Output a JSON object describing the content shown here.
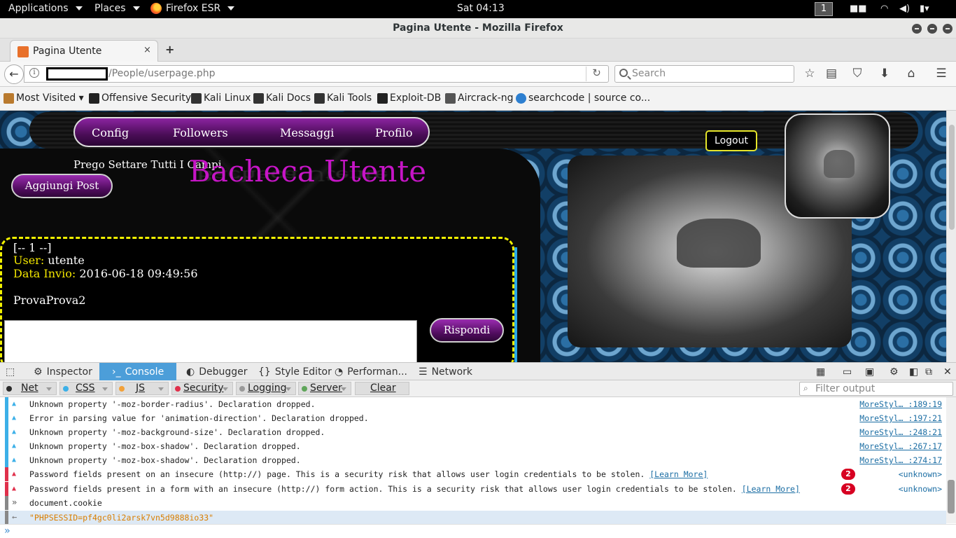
{
  "topbar": {
    "applications": "Applications",
    "places": "Places",
    "firefox": "Firefox ESR",
    "clock": "Sat 04:13",
    "workspace": "1"
  },
  "window": {
    "title": "Pagina Utente - Mozilla Firefox"
  },
  "tab": {
    "label": "Pagina Utente",
    "close": "×",
    "new": "+"
  },
  "nav": {
    "url_path": "/People/userpage.php",
    "search_placeholder": "Search"
  },
  "bookmarks": [
    {
      "label": "Most Visited ▾",
      "color": "#b97a2e"
    },
    {
      "label": "Offensive Security",
      "color": "#222222"
    },
    {
      "label": "Kali Linux",
      "color": "#333333"
    },
    {
      "label": "Kali Docs",
      "color": "#333333"
    },
    {
      "label": "Kali Tools",
      "color": "#333333"
    },
    {
      "label": "Exploit-DB",
      "color": "#222222"
    },
    {
      "label": "Aircrack-ng",
      "color": "#555555"
    },
    {
      "label": "searchcode | source co...",
      "color": "#2d7fd0"
    }
  ],
  "site": {
    "nav": [
      "Config",
      "Followers",
      "Messaggi",
      "Profilo"
    ],
    "logout": "Logout",
    "prego": "Prego Settare Tutti I Campi",
    "heading": "Bacheca Utente",
    "add_post": "Aggiungi Post",
    "post": {
      "index": "[-- 1 --]",
      "user_label": "User:",
      "user": "utente",
      "date_label": "Data Invio:",
      "date": "2016-06-18 09:49:56",
      "body": "ProvaProva2",
      "reply": "Rispondi"
    }
  },
  "devtools": {
    "tabs": [
      "Inspector",
      "Console",
      "Debugger",
      "Style Editor",
      "Performan...",
      "Network"
    ],
    "active_tab": "Console",
    "filters": [
      {
        "label": "Net",
        "color": "#2a2a2a"
      },
      {
        "label": "CSS",
        "color": "#3cb0e8"
      },
      {
        "label": "JS",
        "color": "#f2a13a"
      },
      {
        "label": "Security",
        "color": "#e0304b"
      },
      {
        "label": "Logging",
        "color": "#999999"
      },
      {
        "label": "Server",
        "color": "#5fa55a"
      }
    ],
    "clear": "Clear",
    "filter_placeholder": "Filter output",
    "messages": [
      {
        "type": "warn",
        "text": "Unknown property '-moz-border-radius'.  Declaration dropped.",
        "loc": "MoreStyl… :189:19"
      },
      {
        "type": "warn",
        "text": "Error in parsing value for 'animation-direction'.  Declaration dropped.",
        "loc": "MoreStyl… :197:21"
      },
      {
        "type": "warn",
        "text": "Unknown property '-moz-background-size'.  Declaration dropped.",
        "loc": "MoreStyl… :248:21"
      },
      {
        "type": "warn",
        "text": "Unknown property '-moz-box-shadow'.  Declaration dropped.",
        "loc": "MoreStyl… :267:17"
      },
      {
        "type": "warn",
        "text": "Unknown property '-moz-box-shadow'.  Declaration dropped.",
        "loc": "MoreStyl… :274:17"
      },
      {
        "type": "sec",
        "text": "Password fields present on an insecure (http://) page. This is a security risk that allows user login credentials to be stolen.",
        "link": "[Learn More]",
        "count": "2",
        "loc": "<unknown>"
      },
      {
        "type": "sec",
        "text": "Password fields present in a form with an insecure (http://) form action. This is a security risk that allows user login credentials to be stolen.",
        "link": "[Learn More]",
        "count": "2",
        "loc": "<unknown>"
      },
      {
        "type": "input",
        "text": "document.cookie"
      },
      {
        "type": "output",
        "text": "\"PHPSESSID=pf4gc0li2arsk7vn5d9888io33\""
      }
    ]
  }
}
